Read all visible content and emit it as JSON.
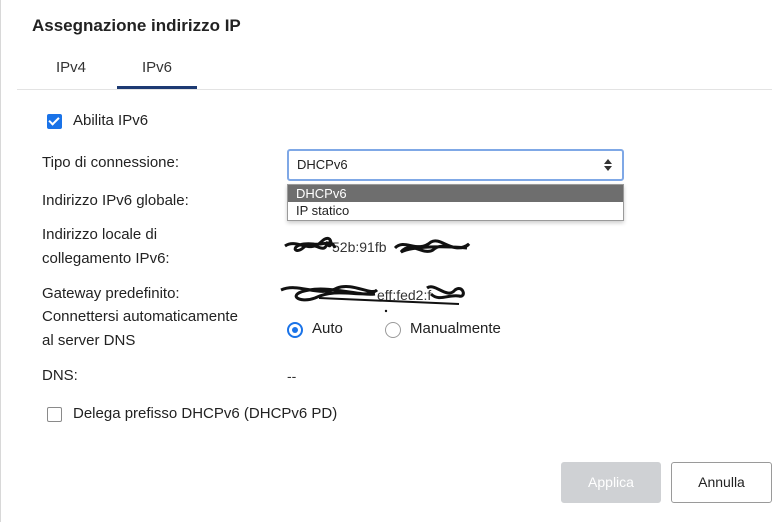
{
  "dialog": {
    "title": "Assegnazione indirizzo IP",
    "tabs": [
      {
        "label": "IPv4",
        "active": false
      },
      {
        "label": "IPv6",
        "active": true
      }
    ]
  },
  "form": {
    "enable_ipv6": {
      "label": "Abilita IPv6",
      "checked": true
    },
    "connection_type": {
      "label": "Tipo di connessione:",
      "selected": "DHCPv6",
      "options": [
        "DHCPv6",
        "IP statico"
      ]
    },
    "global_address": {
      "label": "Indirizzo IPv6 globale:"
    },
    "link_local": {
      "label_line1": "Indirizzo locale di",
      "label_line2": "collegamento IPv6:",
      "value_visible": "52b:91fb"
    },
    "gateway": {
      "label": "Gateway predefinito:",
      "value_visible": "eff:fed2:f"
    },
    "dns_auto": {
      "label_line1": "Connettersi automaticamente",
      "label_line2": "al server DNS",
      "option_auto": "Auto",
      "option_manual": "Manualmente",
      "selected": "Auto"
    },
    "dns": {
      "label": "DNS:",
      "value": "--"
    },
    "prefix_delegation": {
      "label": "Delega prefisso DHCPv6 (DHCPv6 PD)",
      "checked": false
    }
  },
  "buttons": {
    "apply": "Applica",
    "cancel": "Annulla"
  },
  "colors": {
    "accent": "#1a73e8",
    "tab_underline": "#1d3a73",
    "disabled_button": "#cfd1d4"
  }
}
